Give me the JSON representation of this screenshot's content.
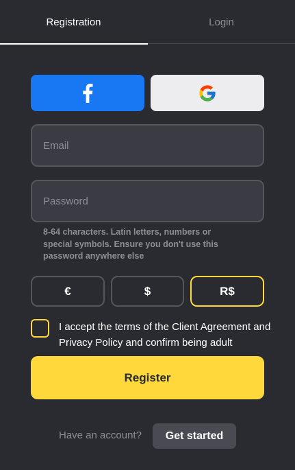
{
  "tabs": {
    "registration": "Registration",
    "login": "Login"
  },
  "social": {
    "facebook_icon": "facebook-f-icon",
    "google_icon": "google-g-icon"
  },
  "form": {
    "email_placeholder": "Email",
    "email_value": "",
    "password_placeholder": "Password",
    "password_value": "",
    "password_hint": "8-64 characters. Latin letters, numbers or special symbols. Ensure you don't use this password anywhere else"
  },
  "currencies": {
    "options": [
      "€",
      "$",
      "R$"
    ],
    "selected": "R$"
  },
  "terms": {
    "checked": false,
    "text": "I accept the terms of the Client Agreement and Privacy Policy and confirm being adult"
  },
  "register_label": "Register",
  "footer": {
    "have_account": "Have an account?",
    "get_started": "Get started"
  },
  "colors": {
    "background": "#2a2b31",
    "accent": "#ffd83c",
    "facebook": "#1877f2",
    "google_bg": "#ededf0"
  }
}
